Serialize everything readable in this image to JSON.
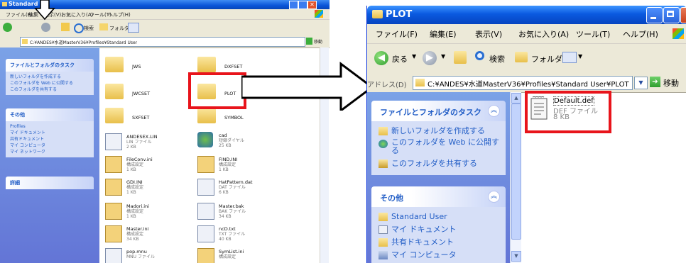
{
  "left_window": {
    "title": "Standard",
    "menu": [
      "ファイル(F)",
      "編集",
      "表示(V)",
      "お気に入り(A)",
      "ツール(T)",
      "ヘルプ(H)"
    ],
    "toolbar": {
      "search": "検索",
      "folders": "フォルダ"
    },
    "address": "C:¥ANDES¥水道MasterV36¥Profiles¥Standard User",
    "go": "移動",
    "tasks": {
      "title": "ファイルとフォルダのタスク",
      "items": [
        "新しいフォルダを作成する",
        "このフォルダを Web に公開する",
        "このフォルダを共有する"
      ]
    },
    "other": {
      "title": "その他",
      "items": [
        "Profiles",
        "マイ ドキュメント",
        "共有ドキュメント",
        "マイ コンピュータ",
        "マイ ネットワーク"
      ]
    },
    "details": {
      "title": "詳細"
    },
    "folders": [
      {
        "name": "JWS"
      },
      {
        "name": "DXFSET"
      },
      {
        "name": "JWCSET"
      },
      {
        "name": "PLOT"
      },
      {
        "name": "SXFSET"
      },
      {
        "name": "SYMBOL"
      }
    ],
    "files": [
      {
        "name": "ANDESEX.LIN",
        "type": "LIN ファイル",
        "size": "2 KB"
      },
      {
        "name": "cad",
        "type": "短縮ダイヤル",
        "size": "25 KB"
      },
      {
        "name": "FileConv.ini",
        "type": "構成設定",
        "size": "1 KB"
      },
      {
        "name": "FIND.INI",
        "type": "構成設定",
        "size": "1 KB"
      },
      {
        "name": "GDI.INI",
        "type": "構成設定",
        "size": "1 KB"
      },
      {
        "name": "HatPattern.dat",
        "type": "DAT ファイル",
        "size": "6 KB"
      },
      {
        "name": "Madori.ini",
        "type": "構成設定",
        "size": "1 KB"
      },
      {
        "name": "Master.bak",
        "type": "BAK ファイル",
        "size": "34 KB"
      },
      {
        "name": "Master.ini",
        "type": "構成設定",
        "size": "34 KB"
      },
      {
        "name": "ncD.txt",
        "type": "TXT ファイル",
        "size": "40 KB"
      },
      {
        "name": "pop.mnu",
        "type": "MNU ファイル",
        "size": ""
      },
      {
        "name": "SymList.ini",
        "type": "構成設定",
        "size": ""
      }
    ]
  },
  "right_window": {
    "title": "PLOT",
    "menu": [
      "ファイル(F)",
      "編集(E)",
      "表示(V)",
      "お気に入り(A)",
      "ツール(T)",
      "ヘルプ(H)"
    ],
    "toolbar": {
      "back": "戻る",
      "search": "検索",
      "folders": "フォルダ"
    },
    "address_label": "アドレス(D)",
    "address": "C:¥ANDES¥水道MasterV36¥Profiles¥Standard User¥PLOT",
    "go": "移動",
    "tasks": {
      "title": "ファイルとフォルダのタスク",
      "items": [
        "新しいフォルダを作成する",
        "このフォルダを Web に公開する",
        "このフォルダを共有する"
      ]
    },
    "other": {
      "title": "その他",
      "items": [
        "Standard User",
        "マイ ドキュメント",
        "共有ドキュメント",
        "マイ コンピュータ"
      ]
    },
    "file": {
      "name": "Default.def",
      "type": "DEF ファイル",
      "size": "8 KB"
    }
  },
  "colors": {
    "highlight": "#e8141b",
    "xp_blue": "#0a5ae0",
    "task_text": "#215dc6"
  }
}
